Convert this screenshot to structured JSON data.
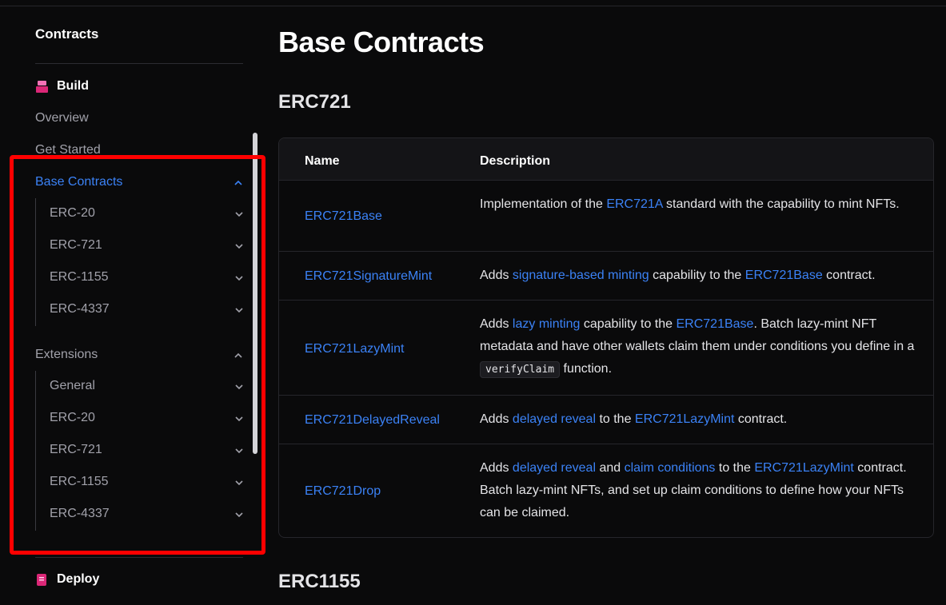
{
  "sidebar": {
    "title": "Contracts",
    "build_label": "Build",
    "overview": "Overview",
    "get_started": "Get Started",
    "base_contracts": {
      "label": "Base Contracts",
      "items": [
        "ERC-20",
        "ERC-721",
        "ERC-1155",
        "ERC-4337"
      ]
    },
    "extensions": {
      "label": "Extensions",
      "items": [
        "General",
        "ERC-20",
        "ERC-721",
        "ERC-1155",
        "ERC-4337"
      ]
    },
    "deploy_label": "Deploy"
  },
  "main": {
    "title": "Base Contracts",
    "section1": "ERC721",
    "section2": "ERC1155",
    "table": {
      "col_name": "Name",
      "col_desc": "Description",
      "rows": [
        {
          "name": "ERC721Base",
          "d": [
            "Implementation of the ",
            "ERC721A",
            " standard with the capability to mint NFTs."
          ]
        },
        {
          "name": "ERC721SignatureMint",
          "d": [
            "Adds ",
            "signature-based minting",
            " capability to the ",
            "ERC721Base",
            " contract."
          ]
        },
        {
          "name": "ERC721LazyMint",
          "d": [
            "Adds ",
            "lazy minting",
            " capability to the ",
            "ERC721Base",
            ". Batch lazy-mint NFT metadata and have other wallets claim them under conditions you define in a ",
            "verifyClaim",
            " function."
          ]
        },
        {
          "name": "ERC721DelayedReveal",
          "d": [
            "Adds ",
            "delayed reveal",
            " to the ",
            "ERC721LazyMint",
            " contract."
          ]
        },
        {
          "name": "ERC721Drop",
          "d": [
            "Adds ",
            "delayed reveal",
            " and ",
            "claim conditions",
            " to the ",
            "ERC721LazyMint",
            " contract. Batch lazy-mint NFTs, and set up claim conditions to define how your NFTs can be claimed."
          ]
        }
      ]
    }
  },
  "colors": {
    "accent": "#3b82f6",
    "highlight": "#ff0000",
    "build_icon": "#ec4899",
    "deploy_icon": "#ec4899"
  }
}
